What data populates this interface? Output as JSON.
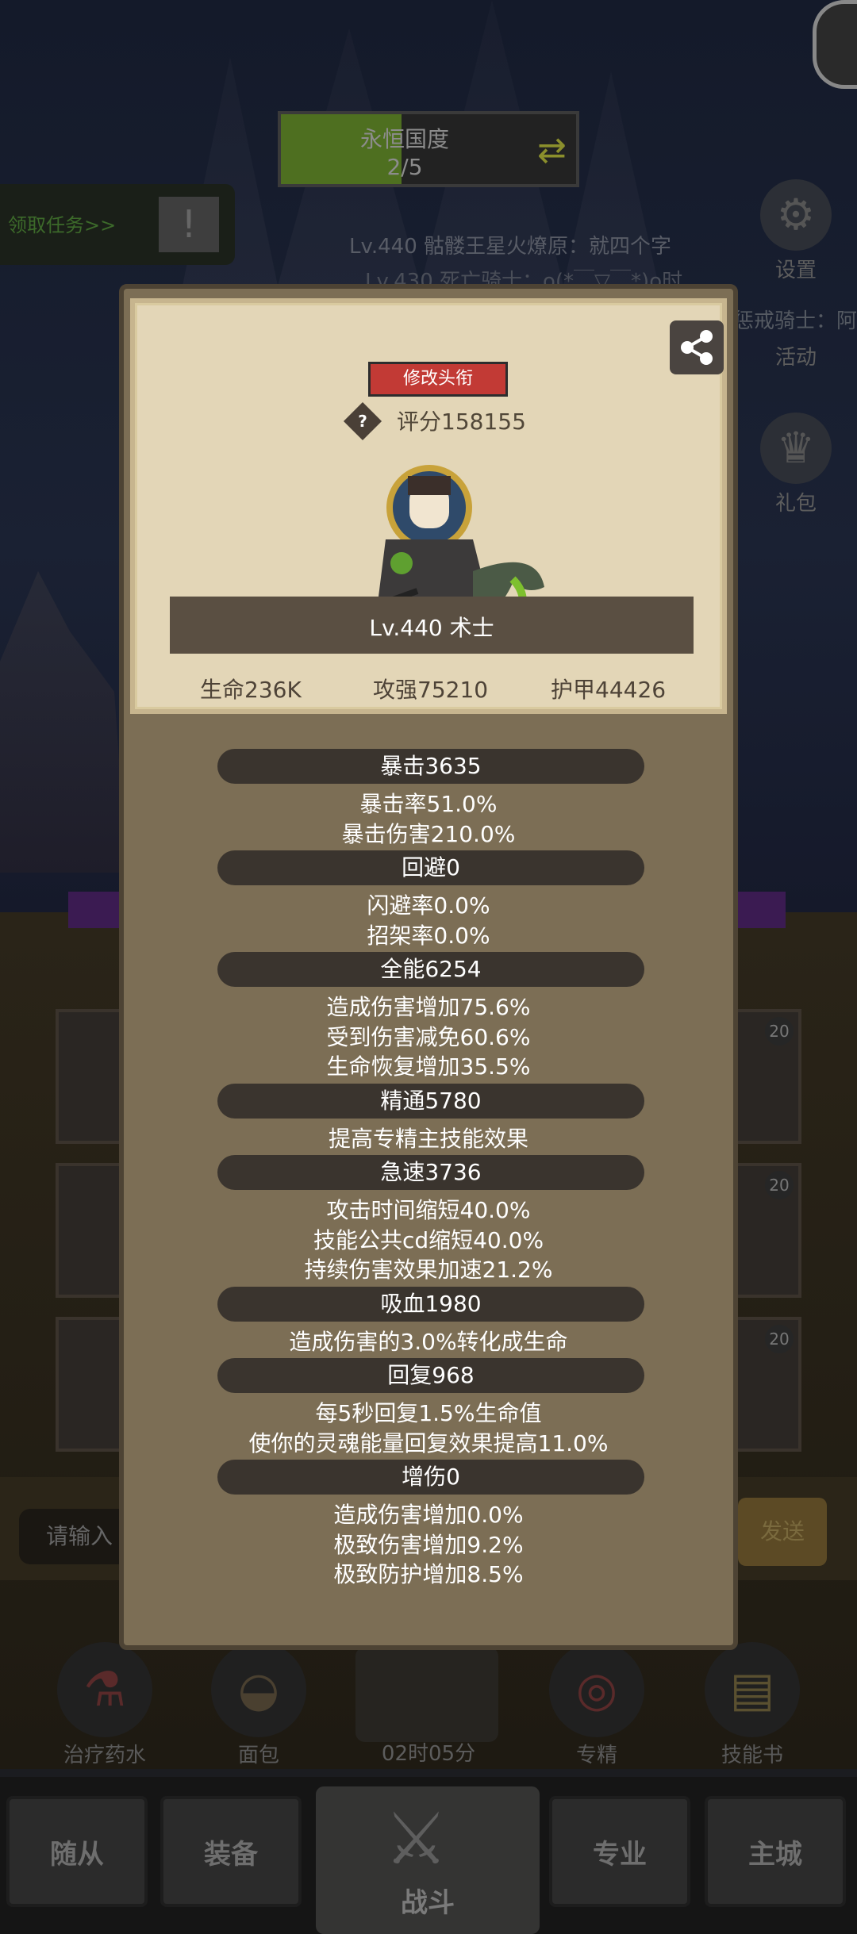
{
  "background": {
    "progress": {
      "title": "永恒国度",
      "count": "2/5",
      "fill": 0.4
    },
    "quest": {
      "label": "领取任务>>",
      "icon": "exclamation-icon"
    },
    "marquee": [
      "Lv.440 骷髅王星火燎原：就四个字",
      "Lv.430 死亡骑士：o(*￣▽￣*)o时"
    ],
    "side_menu": [
      {
        "label": "设置",
        "icon": "gear-icon"
      },
      {
        "label": "活动",
        "icon": "calendar-icon"
      },
      {
        "label": "礼包",
        "icon": "gift-icon"
      }
    ],
    "side_marquee": "惩戒骑士：阿",
    "slot_badge": "20",
    "chat": {
      "placeholder": "请输入",
      "send": "发送"
    },
    "items": [
      {
        "label": "治疗药水",
        "icon": "potion-icon"
      },
      {
        "label": "面包",
        "icon": "bread-icon"
      },
      {
        "label": "专精",
        "icon": "target-icon"
      },
      {
        "label": "技能书",
        "icon": "book-icon"
      }
    ],
    "timer": "02时05分",
    "tabs": [
      "随从",
      "装备",
      "战斗",
      "专业",
      "主城"
    ]
  },
  "card": {
    "edit_title": "修改头衔",
    "score": "评分158155",
    "name": "Lv.440 术士",
    "stats": [
      "生命236K",
      "攻强75210",
      "护甲44426"
    ]
  },
  "sections": [
    {
      "header": "暴击3635",
      "lines": [
        "暴击率51.0%",
        "暴击伤害210.0%"
      ]
    },
    {
      "header": "回避0",
      "lines": [
        "闪避率0.0%",
        "招架率0.0%"
      ]
    },
    {
      "header": "全能6254",
      "lines": [
        "造成伤害增加75.6%",
        "受到伤害减免60.6%",
        "生命恢复增加35.5%"
      ]
    },
    {
      "header": "精通5780",
      "lines": [
        "提高专精主技能效果"
      ]
    },
    {
      "header": "急速3736",
      "lines": [
        "攻击时间缩短40.0%",
        "技能公共cd缩短40.0%",
        "持续伤害效果加速21.2%"
      ]
    },
    {
      "header": "吸血1980",
      "lines": [
        "造成伤害的3.0%转化成生命"
      ]
    },
    {
      "header": "回复968",
      "lines": [
        "每5秒回复1.5%生命值",
        "使你的灵魂能量回复效果提高11.0%"
      ]
    },
    {
      "header": "增伤0",
      "lines": [
        "造成伤害增加0.0%",
        "极致伤害增加9.2%",
        "极致防护增加8.5%"
      ]
    }
  ],
  "colors": {
    "modal_bg": "#7c6e55",
    "card_bg": "#e3d6b7",
    "edit_btn": "#c23a35",
    "section_header": "#3a342e"
  }
}
